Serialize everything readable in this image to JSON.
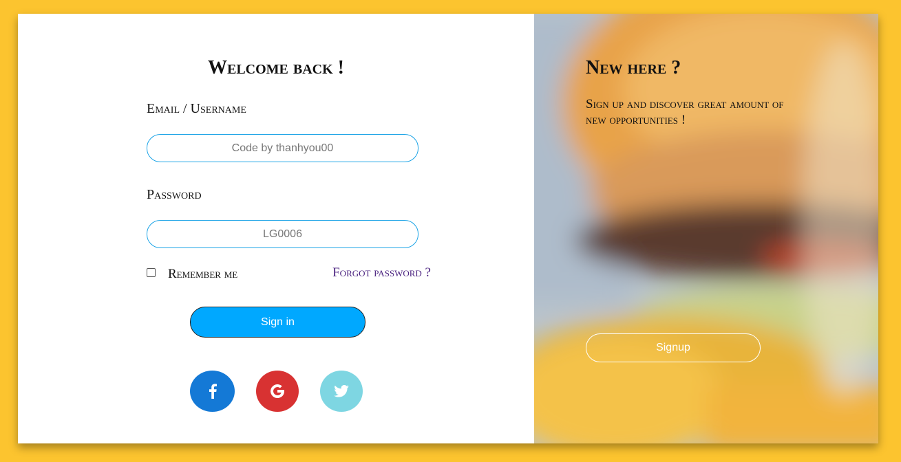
{
  "login": {
    "heading": "Welcome back !",
    "email_label": "Email / Username",
    "email_placeholder": "Code by thanhyou00",
    "password_label": "Password",
    "password_placeholder": "LG0006",
    "remember_label": "Remember me",
    "remember_checked": false,
    "forgot_link": "Forgot password ?",
    "signin_label": "Sign in",
    "social": [
      {
        "icon": "facebook-icon",
        "color": "#1479d6"
      },
      {
        "icon": "google-icon",
        "color": "#d83232"
      },
      {
        "icon": "twitter-icon",
        "color": "#7ed6e2"
      }
    ]
  },
  "signup_panel": {
    "heading": "New here ?",
    "text": "Sign up and discover great amount of new opportunities !",
    "button_label": "Signup",
    "background_image": "blurred burger and fries photo"
  },
  "colors": {
    "page_background": "#fcc42f",
    "accent": "#00a8ff",
    "input_border": "#1aa3e6",
    "link": "#4b2380"
  }
}
